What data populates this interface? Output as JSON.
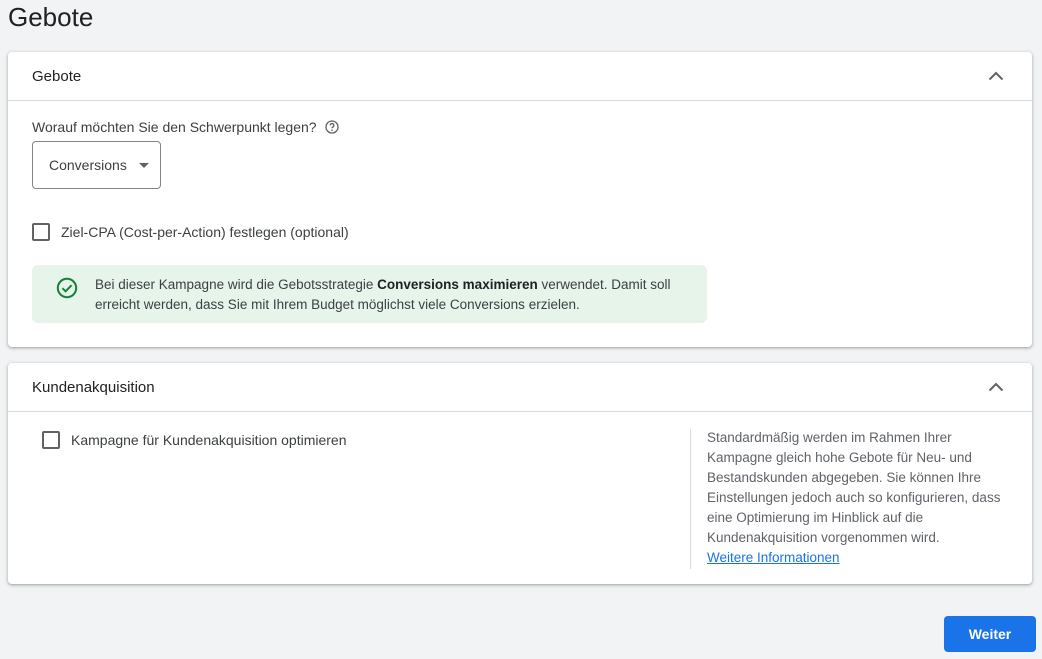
{
  "page": {
    "title": "Gebote"
  },
  "bidding_card": {
    "title": "Gebote",
    "question": "Worauf möchten Sie den Schwerpunkt legen?",
    "dropdown_value": "Conversions",
    "target_cpa_label": "Ziel-CPA (Cost-per-Action) festlegen (optional)",
    "notice_before": "Bei dieser Kampagne wird die Gebotsstrategie ",
    "notice_bold": "Conversions maximieren",
    "notice_after": " verwendet. Damit soll erreicht werden, dass Sie mit Ihrem Budget möglichst viele Conversions erzielen."
  },
  "acquisition_card": {
    "title": "Kundenakquisition",
    "checkbox_label": "Kampagne für Kundenakquisition optimieren",
    "side_text": "Standardmäßig werden im Rahmen Ihrer Kampagne gleich hohe Gebote für Neu- und Bestandskunden abgegeben. Sie können Ihre Einstellungen jedoch auch so konfigurieren, dass eine Optimierung im Hinblick auf die Kundenakquisition vorgenommen wird.",
    "link": "Weitere Informationen"
  },
  "footer": {
    "next_label": "Weiter"
  },
  "colors": {
    "accent": "#1a73e8",
    "success": "#188038",
    "notice_bg": "#e6f4ea"
  },
  "icons": {
    "collapse": "chevron-up-icon",
    "help": "help-icon",
    "success": "check-circle-icon"
  }
}
